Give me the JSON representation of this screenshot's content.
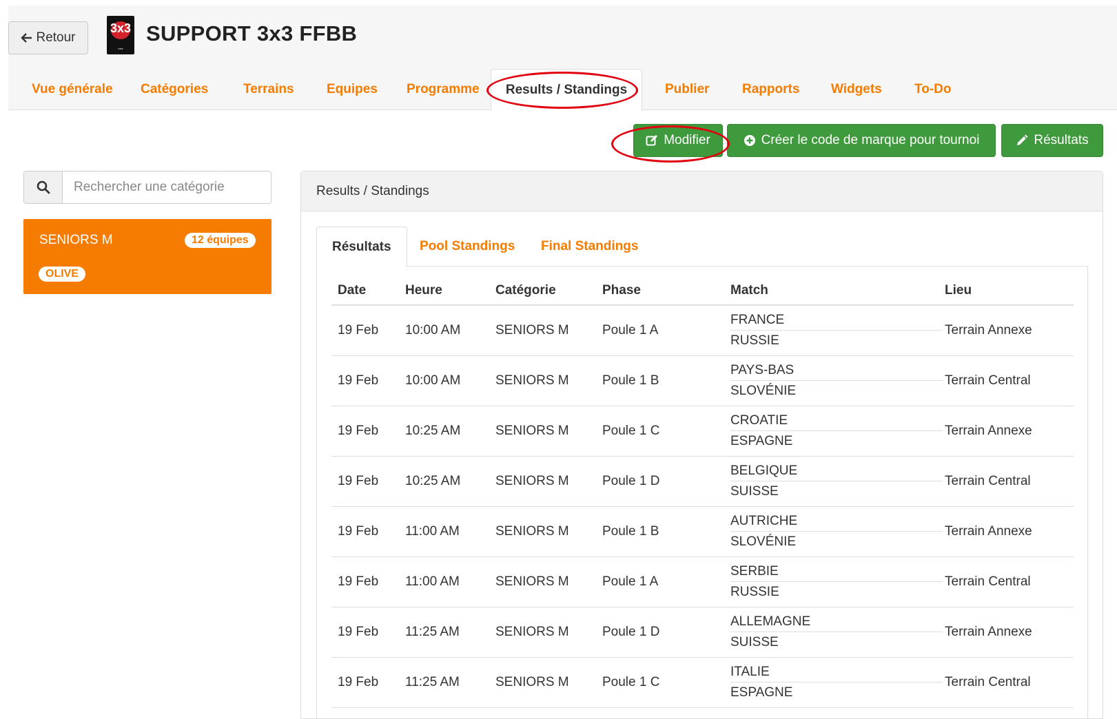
{
  "header": {
    "back_label": "Retour",
    "back_icon": "arrow-left-icon",
    "logo_text": "3x3",
    "title": "SUPPORT 3x3 FFBB"
  },
  "nav": {
    "tabs": [
      {
        "label": "Vue générale"
      },
      {
        "label": "Catégories"
      },
      {
        "label": "Terrains"
      },
      {
        "label": "Equipes"
      },
      {
        "label": "Programme"
      },
      {
        "label": "Results / Standings",
        "active": true
      },
      {
        "label": "Publier"
      },
      {
        "label": "Rapports"
      },
      {
        "label": "Widgets"
      },
      {
        "label": "To-Do"
      }
    ]
  },
  "toolbar": {
    "modifier_label": "Modifier",
    "modifier_icon": "edit-icon",
    "create_code_label": "Créer le code de marque pour tournoi",
    "create_code_icon": "plus-circle-icon",
    "results_label": "Résultats",
    "results_icon": "pencil-icon"
  },
  "sidebar": {
    "search_placeholder": "Rechercher une catégorie",
    "search_icon": "search-icon",
    "category": {
      "name": "SENIORS M",
      "teams_badge": "12 équipes",
      "color_badge": "OLIVE"
    }
  },
  "panel": {
    "title": "Results / Standings",
    "subtabs": [
      {
        "label": "Résultats",
        "active": true
      },
      {
        "label": "Pool Standings"
      },
      {
        "label": "Final Standings"
      }
    ],
    "columns": [
      "Date",
      "Heure",
      "Catégorie",
      "Phase",
      "Match",
      "Lieu"
    ],
    "rows": [
      {
        "date": "19 Feb",
        "time": "10:00 AM",
        "category": "SENIORS M",
        "phase": "Poule 1 A",
        "home": "FRANCE",
        "away": "RUSSIE",
        "venue": "Terrain Annexe"
      },
      {
        "date": "19 Feb",
        "time": "10:00 AM",
        "category": "SENIORS M",
        "phase": "Poule 1 B",
        "home": "PAYS-BAS",
        "away": "SLOVÉNIE",
        "venue": "Terrain Central"
      },
      {
        "date": "19 Feb",
        "time": "10:25 AM",
        "category": "SENIORS M",
        "phase": "Poule 1 C",
        "home": "CROATIE",
        "away": "ESPAGNE",
        "venue": "Terrain Annexe"
      },
      {
        "date": "19 Feb",
        "time": "10:25 AM",
        "category": "SENIORS M",
        "phase": "Poule 1 D",
        "home": "BELGIQUE",
        "away": "SUISSE",
        "venue": "Terrain Central"
      },
      {
        "date": "19 Feb",
        "time": "11:00 AM",
        "category": "SENIORS M",
        "phase": "Poule 1 B",
        "home": "AUTRICHE",
        "away": "SLOVÉNIE",
        "venue": "Terrain Annexe"
      },
      {
        "date": "19 Feb",
        "time": "11:00 AM",
        "category": "SENIORS M",
        "phase": "Poule 1 A",
        "home": "SERBIE",
        "away": "RUSSIE",
        "venue": "Terrain Central"
      },
      {
        "date": "19 Feb",
        "time": "11:25 AM",
        "category": "SENIORS M",
        "phase": "Poule 1 D",
        "home": "ALLEMAGNE",
        "away": "SUISSE",
        "venue": "Terrain Annexe"
      },
      {
        "date": "19 Feb",
        "time": "11:25 AM",
        "category": "SENIORS M",
        "phase": "Poule 1 C",
        "home": "ITALIE",
        "away": "ESPAGNE",
        "venue": "Terrain Central"
      }
    ]
  },
  "colors": {
    "accent": "#f57c00",
    "success": "#3e9a3c",
    "annotation": "#e1000f"
  }
}
